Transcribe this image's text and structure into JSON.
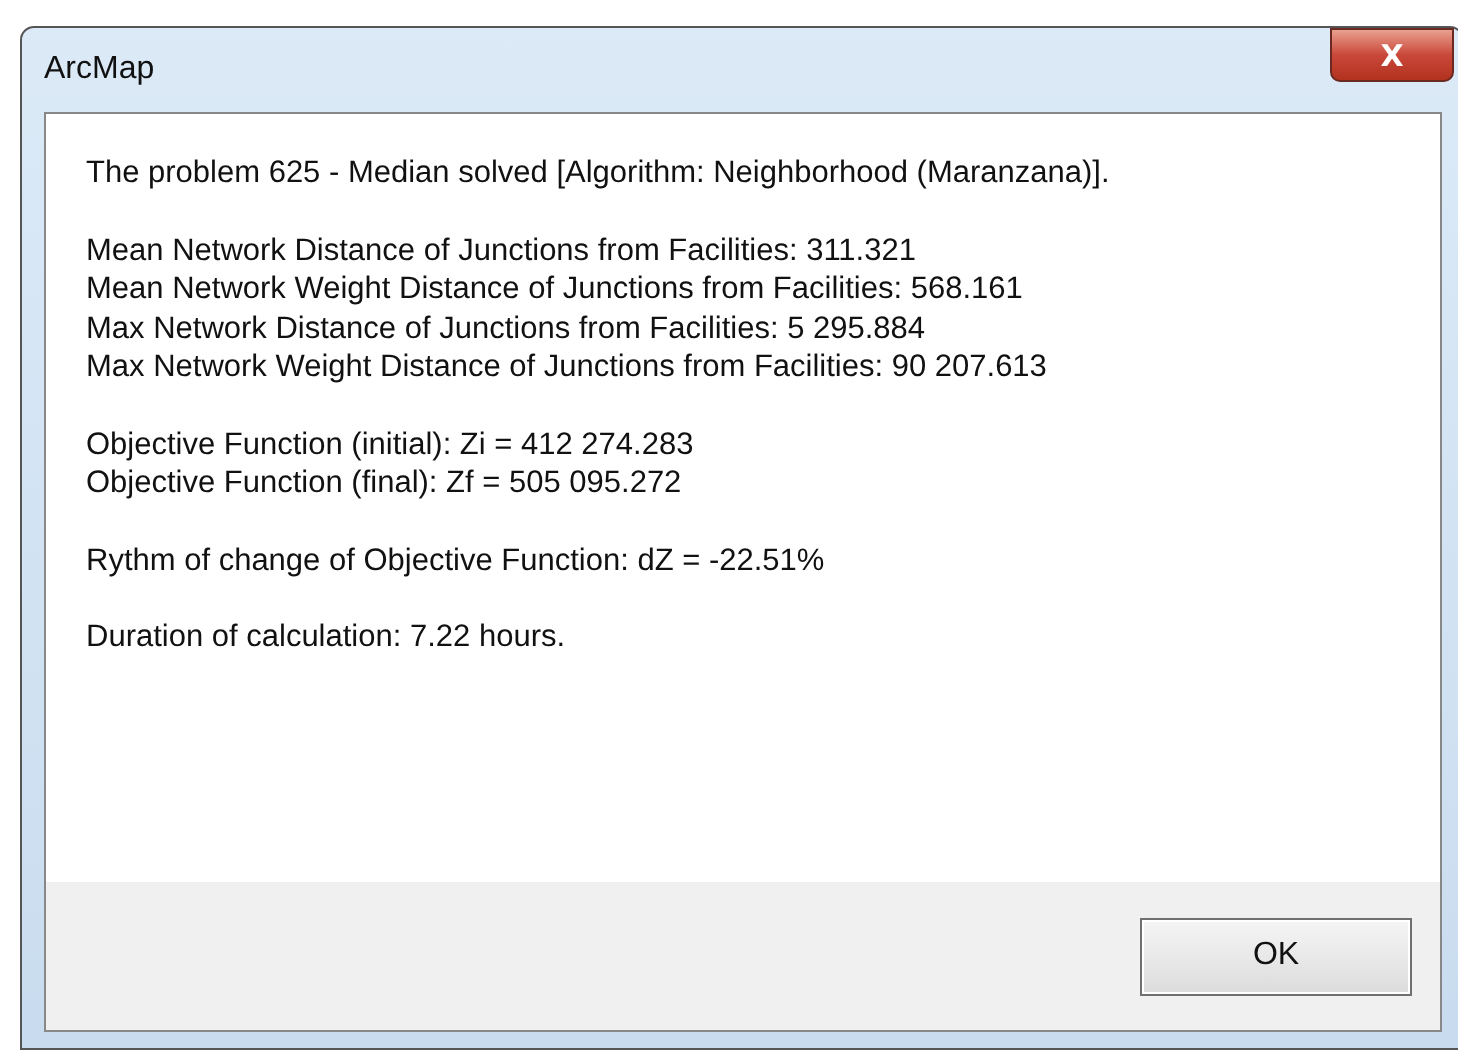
{
  "window": {
    "title": "ArcMap",
    "close": "X"
  },
  "message": {
    "paragraphs": [
      [
        "The problem 625 - Median solved [Algorithm: Neighborhood (Maranzana)]."
      ],
      [
        "Mean Network Distance of Junctions from Facilities: 311.321",
        "Mean Network Weight Distance of Junctions from Facilities: 568.161",
        "Max Network Distance of Junctions from Facilities: 5 295.884",
        "Max Network Weight Distance of Junctions from Facilities: 90 207.613"
      ],
      [
        "Objective Function (initial): Zi = 412 274.283",
        "Objective Function (final): Zf = 505 095.272"
      ],
      [
        "Rythm of change of Objective Function: dZ = -22.51%"
      ],
      [
        "Duration of calculation: 7.22 hours."
      ]
    ]
  },
  "buttons": [
    "OK"
  ]
}
